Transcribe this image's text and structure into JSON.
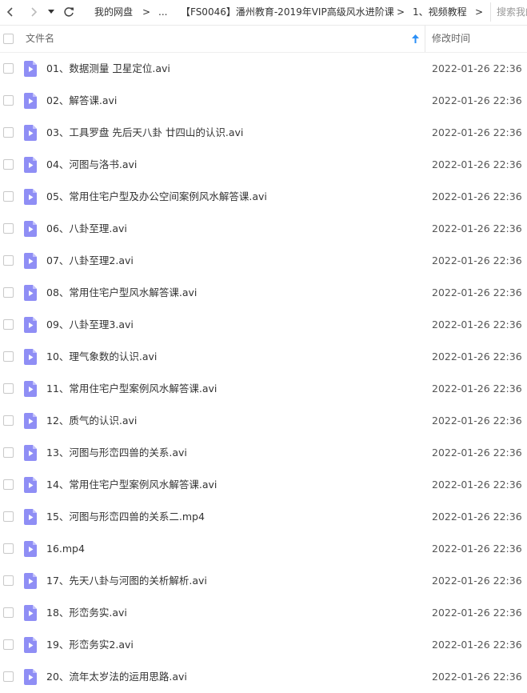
{
  "toolbar": {
    "back_icon": "chevron-left-icon",
    "forward_icon": "chevron-right-icon",
    "history_icon": "caret-down-icon",
    "refresh_icon": "refresh-icon",
    "breadcrumb": [
      "我的网盘",
      "...",
      "【FS0046】潘州教育-2019年VIP高级风水进阶课",
      "1、视频教程"
    ],
    "separator": ">",
    "search_placeholder": "搜索我的"
  },
  "header": {
    "name_label": "文件名",
    "time_label": "修改时间",
    "sort_icon": "arrow-up-icon",
    "accent_color": "#2b8ff7"
  },
  "files": [
    {
      "name": "01、数据测量 卫星定位.avi",
      "time": "2022-01-26 22:36"
    },
    {
      "name": "02、解答课.avi",
      "time": "2022-01-26 22:36"
    },
    {
      "name": "03、工具罗盘 先后天八卦 廿四山的认识.avi",
      "time": "2022-01-26 22:36"
    },
    {
      "name": "04、河图与洛书.avi",
      "time": "2022-01-26 22:36"
    },
    {
      "name": "05、常用住宅户型及办公空间案例风水解答课.avi",
      "time": "2022-01-26 22:36"
    },
    {
      "name": "06、八卦至理.avi",
      "time": "2022-01-26 22:36"
    },
    {
      "name": "07、八卦至理2.avi",
      "time": "2022-01-26 22:36"
    },
    {
      "name": "08、常用住宅户型风水解答课.avi",
      "time": "2022-01-26 22:36"
    },
    {
      "name": "09、八卦至理3.avi",
      "time": "2022-01-26 22:36"
    },
    {
      "name": "10、理气象数的认识.avi",
      "time": "2022-01-26 22:36"
    },
    {
      "name": "11、常用住宅户型案例风水解答课.avi",
      "time": "2022-01-26 22:36"
    },
    {
      "name": "12、质气的认识.avi",
      "time": "2022-01-26 22:36"
    },
    {
      "name": "13、河图与形峦四兽的关系.avi",
      "time": "2022-01-26 22:36"
    },
    {
      "name": "14、常用住宅户型案例风水解答课.avi",
      "time": "2022-01-26 22:36"
    },
    {
      "name": "15、河图与形峦四兽的关系二.mp4",
      "time": "2022-01-26 22:36"
    },
    {
      "name": "16.mp4",
      "time": "2022-01-26 22:36"
    },
    {
      "name": "17、先天八卦与河图的关析解析.avi",
      "time": "2022-01-26 22:36"
    },
    {
      "name": "18、形峦务实.avi",
      "time": "2022-01-26 22:36"
    },
    {
      "name": "19、形峦务实2.avi",
      "time": "2022-01-26 22:36"
    },
    {
      "name": "20、流年太岁法的运用思路.avi",
      "time": "2022-01-26 22:36"
    }
  ],
  "file_icon": "video-file-icon",
  "file_icon_color": "#8f8ef5"
}
